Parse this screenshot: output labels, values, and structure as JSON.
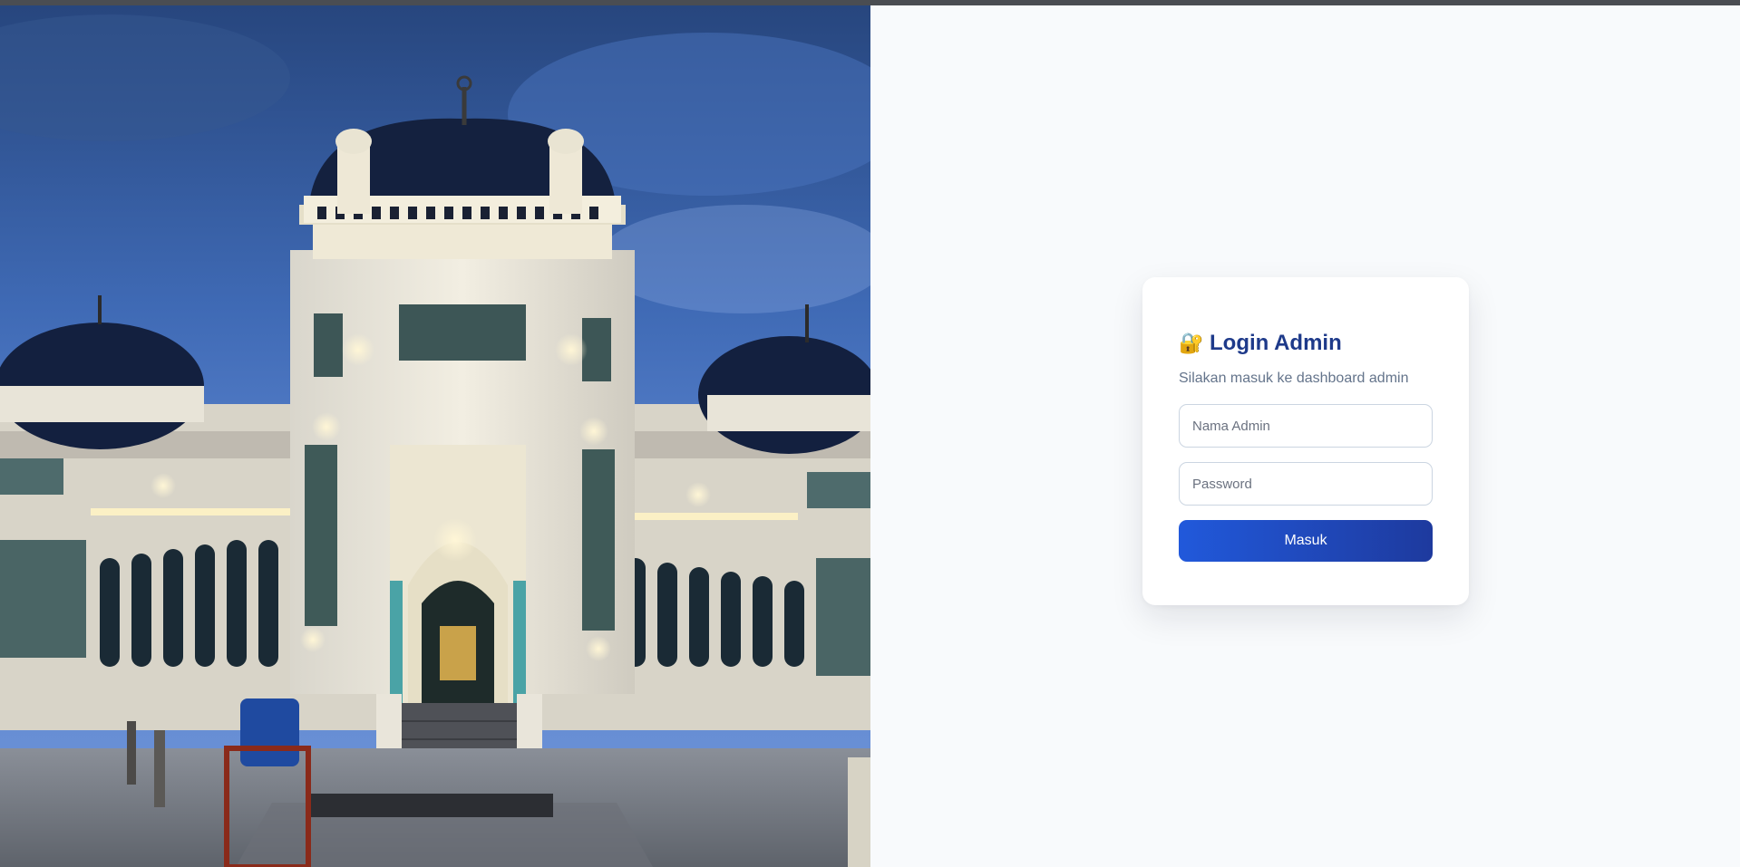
{
  "hero": {
    "image_alt": "Masjid photo"
  },
  "login": {
    "icon": "lock-with-key-icon",
    "icon_glyph": "🔐",
    "title": "Login Admin",
    "subtitle": "Silakan masuk ke dashboard admin",
    "name_placeholder": "Nama Admin",
    "password_placeholder": "Password",
    "submit_label": "Masuk"
  },
  "colors": {
    "title": "#1e3a8a",
    "button_start": "#2159db",
    "button_end": "#1e3a9e",
    "panel_bg": "#f8fafc"
  }
}
